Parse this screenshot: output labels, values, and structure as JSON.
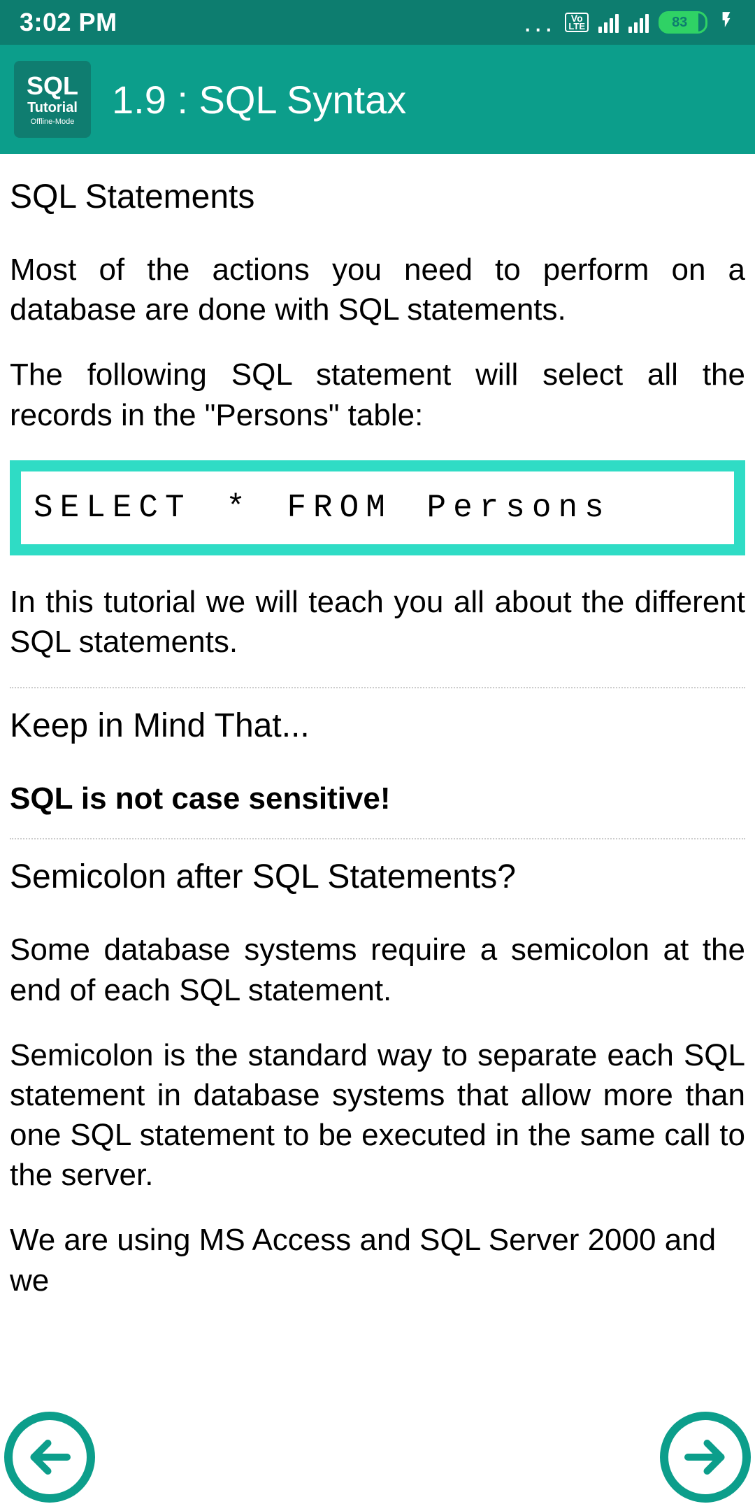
{
  "statusBar": {
    "time": "3:02 PM",
    "volteTop": "Vo",
    "volteBottom": "LTE",
    "battery": "83"
  },
  "appBar": {
    "logo": {
      "line1": "SQL",
      "line2": "Tutorial",
      "line3": "Offline-Mode"
    },
    "title": "1.9 : SQL Syntax"
  },
  "sections": {
    "s1": {
      "heading": "SQL Statements",
      "p1": "Most of the actions you need to perform on a database are done with SQL statements.",
      "p2": "The following SQL statement will select all the records in the \"Persons\" table:",
      "code": "SELECT * FROM Persons",
      "p3": "In this tutorial we will teach you all about the different SQL statements."
    },
    "s2": {
      "heading": "Keep in Mind That...",
      "p1": "SQL is not case sensitive!"
    },
    "s3": {
      "heading": "Semicolon after SQL Statements?",
      "p1": "Some database systems require a semicolon at the end of each SQL statement.",
      "p2": "Semicolon is the standard way to separate each SQL statement in database systems that allow more than one SQL statement to be executed in the same call to the server.",
      "p3": "We are using MS Access and SQL Server 2000 and we"
    }
  }
}
